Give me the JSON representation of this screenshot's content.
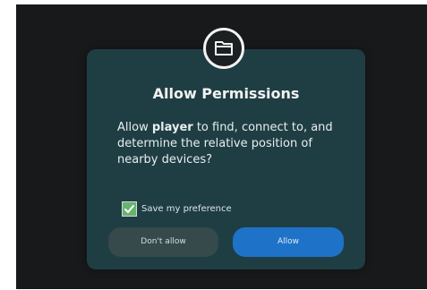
{
  "dialog": {
    "icon": "folder-icon",
    "title": "Allow Permissions",
    "message": {
      "prefix": "Allow ",
      "app_name": "player",
      "suffix": " to find, connect to, and determine the relative position of nearby devices?"
    },
    "preference": {
      "label": "Save my preference",
      "checked": true
    },
    "buttons": {
      "deny": "Don't allow",
      "allow": "Allow"
    }
  },
  "colors": {
    "background": "#17191b",
    "dialog": "#1f3e44",
    "allow_button": "#1e73c9",
    "deny_button": "#36494b",
    "checkbox": "#67b46f"
  }
}
